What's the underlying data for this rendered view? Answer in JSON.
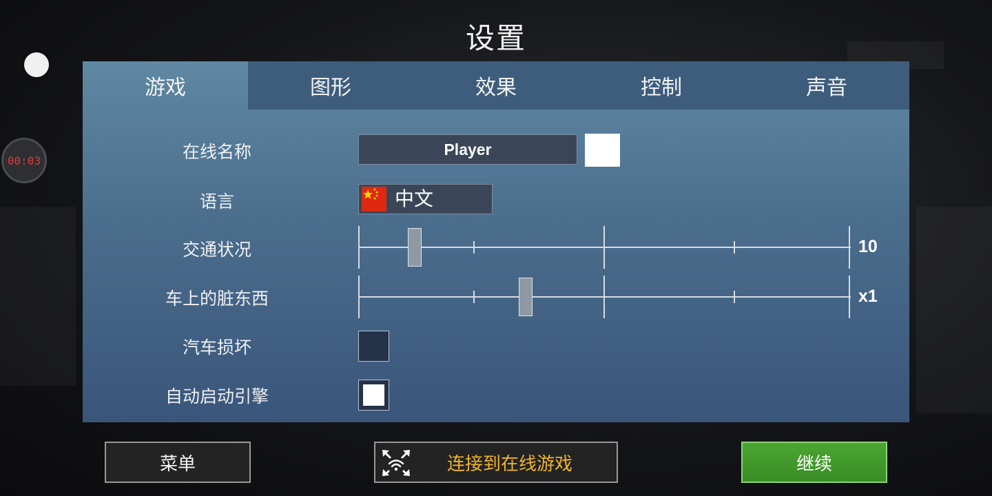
{
  "title": "设置",
  "timer": "00:03",
  "tabs": [
    {
      "label": "游戏",
      "active": true
    },
    {
      "label": "图形",
      "active": false
    },
    {
      "label": "效果",
      "active": false
    },
    {
      "label": "控制",
      "active": false
    },
    {
      "label": "声音",
      "active": false
    }
  ],
  "settings": {
    "online_name": {
      "label": "在线名称",
      "value": "Player",
      "color": "#ffffff"
    },
    "language": {
      "label": "语言",
      "value": "中文",
      "flag_icon": "china-flag-icon"
    },
    "traffic": {
      "label": "交通状况",
      "value": "10",
      "level": 0.115
    },
    "car_dirt": {
      "label": "车上的脏东西",
      "value": "x1",
      "level": 0.34
    },
    "car_damage": {
      "label": "汽车损坏",
      "checked": false
    },
    "auto_start_engine": {
      "label": "自动启动引擎",
      "checked": true
    }
  },
  "buttons": {
    "menu": "菜单",
    "connect_online": "连接到在线游戏",
    "connect_icon": "online-network-icon",
    "continue": "继续"
  },
  "colors": {
    "panel_top": "#5f88a2",
    "panel_bottom": "#3a557a",
    "tab_inactive": "#3e5d7c",
    "online_text": "#f0b429",
    "continue_green": "#3a8d25",
    "timer_red": "#e23a3a"
  }
}
